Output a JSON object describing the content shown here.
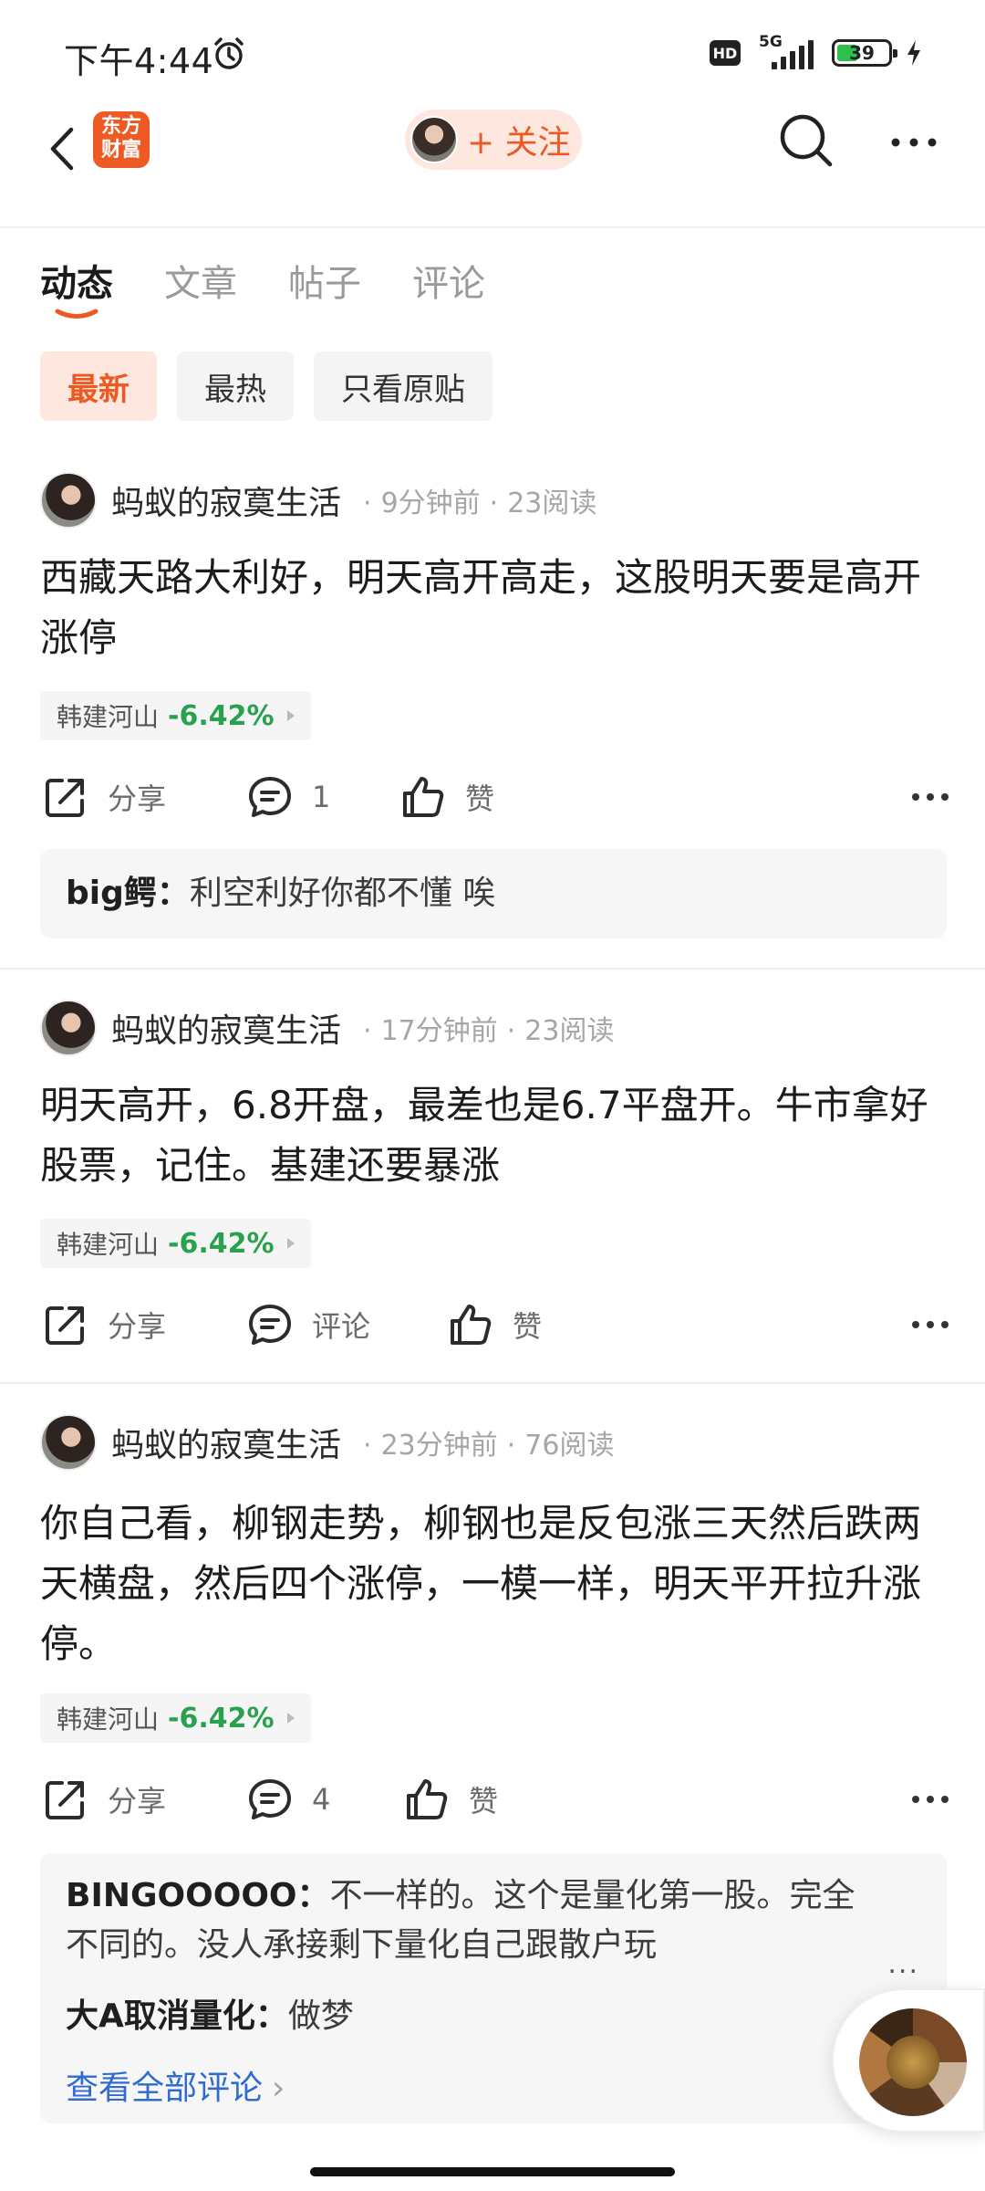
{
  "status_bar": {
    "time": "下午4:44",
    "hd": "HD",
    "network": "5G",
    "battery": "39"
  },
  "header": {
    "logo_line1": "东方",
    "logo_line2": "财富",
    "follow_label": "+ 关注"
  },
  "tabs": [
    {
      "label": "动态",
      "active": true
    },
    {
      "label": "文章",
      "active": false
    },
    {
      "label": "帖子",
      "active": false
    },
    {
      "label": "评论",
      "active": false
    }
  ],
  "filters": [
    {
      "label": "最新",
      "active": true
    },
    {
      "label": "最热",
      "active": false
    },
    {
      "label": "只看原贴",
      "active": false
    }
  ],
  "posts": [
    {
      "author": "蚂蚁的寂寞生活",
      "time": "9分钟前",
      "reads": "23阅读",
      "text": "西藏天路大利好，明天高开高走，这股明天要是高开涨停",
      "stock_name": "韩建河山",
      "stock_change": "-6.42%",
      "share": "分享",
      "comment": "1",
      "like": "赞",
      "comments": [
        {
          "user": "big鳄：",
          "text": "利空利好你都不懂 唉"
        }
      ]
    },
    {
      "author": "蚂蚁的寂寞生活",
      "time": "17分钟前",
      "reads": "23阅读",
      "text": "明天高开，6.8开盘，最差也是6.7平盘开。牛市拿好股票，记住。基建还要暴涨",
      "stock_name": "韩建河山",
      "stock_change": "-6.42%",
      "share": "分享",
      "comment": "评论",
      "like": "赞"
    },
    {
      "author": "蚂蚁的寂寞生活",
      "time": "23分钟前",
      "reads": "76阅读",
      "text": "你自己看，柳钢走势，柳钢也是反包涨三天然后跌两天横盘，然后四个涨停，一模一样，明天平开拉升涨停。",
      "stock_name": "韩建河山",
      "stock_change": "-6.42%",
      "share": "分享",
      "comment": "4",
      "like": "赞",
      "comments": [
        {
          "user": "BINGOOOOO：",
          "text": "不一样的。这个是量化第一股。完全不同的。没人承接剩下量化自己跟散户玩"
        },
        {
          "user": "大A取消量化：",
          "text": "做梦"
        }
      ],
      "view_all": "查看全部评论"
    }
  ],
  "colors": {
    "accent": "#ec5a23",
    "accent_bg": "#fde7df",
    "down_green": "#2aa14e",
    "link_blue": "#2f6bd1"
  }
}
